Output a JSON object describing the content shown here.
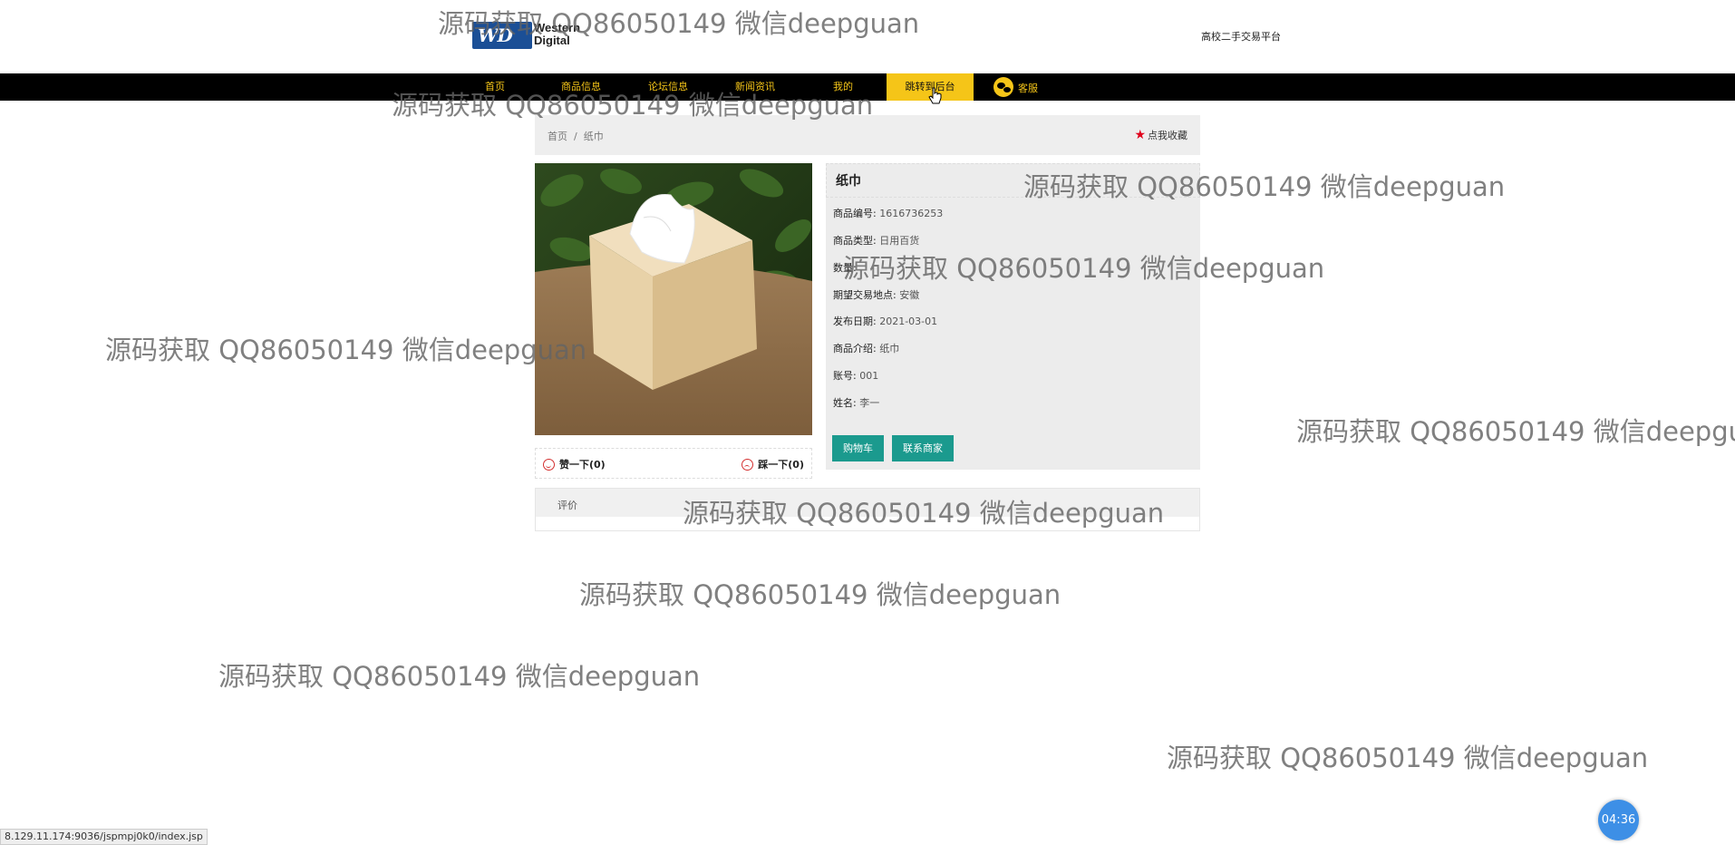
{
  "header": {
    "logo_line1": "Western",
    "logo_line2": "Digital",
    "logo_badge": "WD",
    "site_title": "高校二手交易平台"
  },
  "nav": {
    "items": [
      {
        "label": "首页"
      },
      {
        "label": "商品信息"
      },
      {
        "label": "论坛信息"
      },
      {
        "label": "新闻资讯"
      },
      {
        "label": "我的"
      },
      {
        "label": "跳转到后台",
        "active": true
      },
      {
        "label": "客服",
        "icon": "wechat-icon"
      }
    ],
    "active_color": "#f5c518"
  },
  "breadcrumb": {
    "home": "首页",
    "sep": "/",
    "current": "纸巾",
    "favorite_label": "点我收藏",
    "favorite_icon": "star-icon"
  },
  "product": {
    "name": "纸巾",
    "image_subject": "tissue-box-photo",
    "fields": [
      {
        "key": "商品编号:",
        "value": "1616736253"
      },
      {
        "key": "商品类型:",
        "value": "日用百货"
      },
      {
        "key": "数量:",
        "value": ""
      },
      {
        "key": "期望交易地点:",
        "value": "安徽"
      },
      {
        "key": "发布日期:",
        "value": "2021-03-01"
      },
      {
        "key": "商品介绍:",
        "value": "纸巾"
      },
      {
        "key": "账号:",
        "value": "001"
      },
      {
        "key": "姓名:",
        "value": "李一"
      }
    ],
    "buttons": {
      "cart": "购物车",
      "contact": "联系商家"
    },
    "like_label": "赞一下(0)",
    "dislike_label": "踩一下(0)"
  },
  "review": {
    "tab_label": "评价"
  },
  "watermark": "源码获取 QQ86050149 微信deepguan",
  "status_url": "8.129.11.174:9036/jspmpj0k0/index.jsp",
  "timer": "04:36",
  "colors": {
    "nav_bg": "#000000",
    "accent": "#f5c518",
    "button": "#1b9a8e",
    "timer": "#3d8fe6"
  }
}
